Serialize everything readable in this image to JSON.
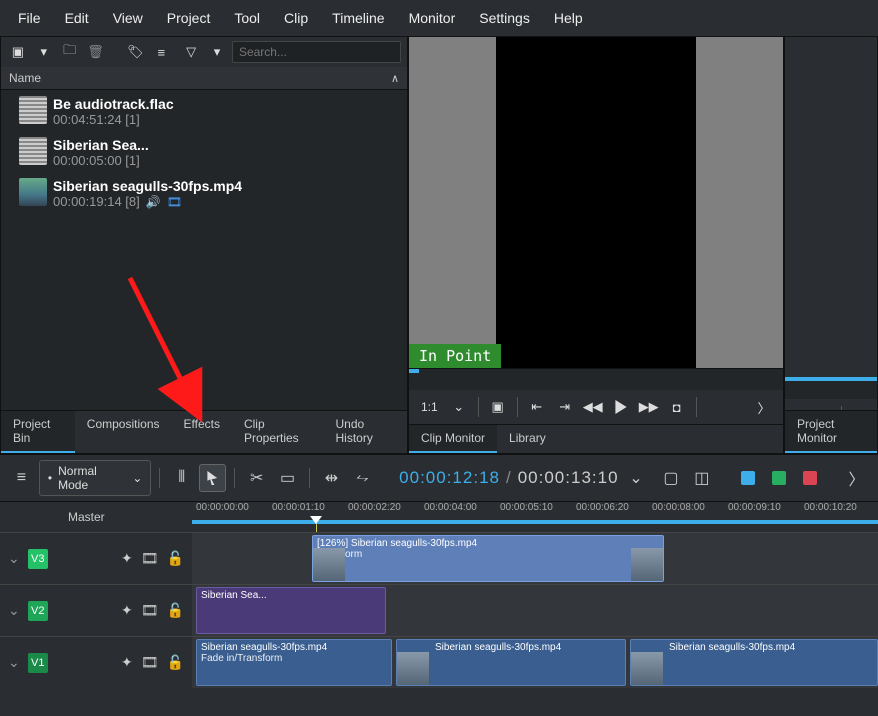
{
  "menu": [
    "File",
    "Edit",
    "View",
    "Project",
    "Tool",
    "Clip",
    "Timeline",
    "Monitor",
    "Settings",
    "Help"
  ],
  "search": {
    "placeholder": "Search..."
  },
  "name_header": "Name",
  "bin": [
    {
      "title": "Be audiotrack.flac",
      "meta": "00:04:51:24 [1]",
      "type": "audio"
    },
    {
      "title": "Siberian Sea...",
      "meta": "00:00:05:00 [1]",
      "type": "audio"
    },
    {
      "title": "Siberian seagulls-30fps.mp4",
      "meta": "00:00:19:14 [8]",
      "type": "video",
      "icons": true
    }
  ],
  "left_tabs": [
    "Project Bin",
    "Compositions",
    "Effects",
    "Clip Properties",
    "Undo History"
  ],
  "mid_tabs": [
    "Clip Monitor",
    "Library"
  ],
  "right_tab": "Project Monitor",
  "in_point": "In Point",
  "monitor_ratio": "1:1",
  "mode_label": "Normal Mode",
  "timecode_pos": "00:00:12:18",
  "timecode_dur": "00:00:13:10",
  "master": "Master",
  "ruler_ticks": [
    "00:00:00:00",
    "00:00:01:10",
    "00:00:02:20",
    "00:00:04:00",
    "00:00:05:10",
    "00:00:06:20",
    "00:00:08:00",
    "00:00:09:10",
    "00:00:10:20"
  ],
  "tracks": {
    "v3": {
      "label": "V3"
    },
    "v2": {
      "label": "V2"
    },
    "v1": {
      "label": "V1"
    }
  },
  "clips": {
    "v3_a": {
      "title": "[126%] Siberian seagulls-30fps.mp4",
      "sub": "Transform"
    },
    "v2_a": {
      "title": "Siberian Sea..."
    },
    "v1_a": {
      "title": "Siberian seagulls-30fps.mp4",
      "sub": "Fade in/Transform"
    },
    "v1_b": {
      "title": "Siberian seagulls-30fps.mp4"
    },
    "v1_c": {
      "title": "Siberian seagulls-30fps.mp4"
    }
  }
}
